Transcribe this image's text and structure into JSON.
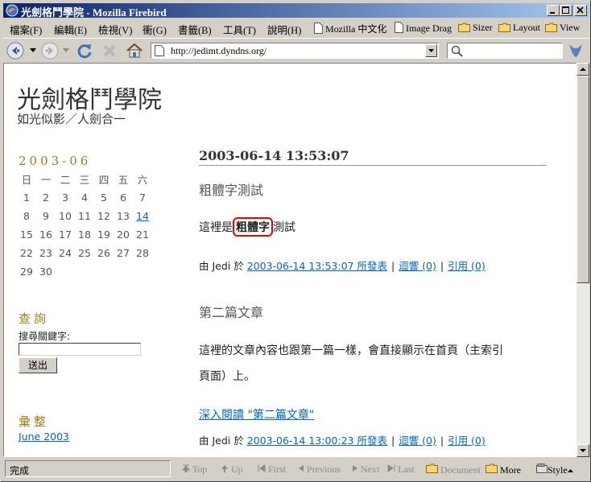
{
  "window": {
    "title": "光劍格鬥學院 - Mozilla Firebird"
  },
  "menubar": {
    "items": [
      "檔案(F)",
      "編輯(E)",
      "檢視(V)",
      "衝(G)",
      "書籤(B)",
      "工具(T)",
      "說明(H)"
    ],
    "bookmarks": [
      "Mozilla 中文化",
      "Image Drag",
      "Sizer",
      "Layout",
      "View"
    ]
  },
  "nav": {
    "url": "http://jedimt.dyndns.org/"
  },
  "site": {
    "title": "光劍格鬥學院",
    "subtitle": "如光似影／人劍合一"
  },
  "calendar": {
    "heading": "2003-06",
    "weekdays": [
      "日",
      "一",
      "二",
      "三",
      "四",
      "五",
      "六"
    ],
    "weeks": [
      [
        "1",
        "2",
        "3",
        "4",
        "5",
        "6",
        "7"
      ],
      [
        "8",
        "9",
        "10",
        "11",
        "12",
        "13",
        "14"
      ],
      [
        "15",
        "16",
        "17",
        "18",
        "19",
        "20",
        "21"
      ],
      [
        "22",
        "23",
        "24",
        "25",
        "26",
        "27",
        "28"
      ],
      [
        "29",
        "30",
        "",
        "",
        "",
        "",
        ""
      ]
    ],
    "today": "14"
  },
  "search": {
    "heading": "查詢",
    "label": "搜尋關鍵字:",
    "button": "送出"
  },
  "archive": {
    "heading": "彙整",
    "link": "June 2003"
  },
  "post1": {
    "date": "2003-06-14 13:53:07",
    "title": "粗體字測試",
    "body_pre": "這裡是",
    "body_bold": "粗體字",
    "body_post": "測試",
    "meta_by": "由 Jedi 於",
    "meta_time": "2003-06-14 13:53:07 所發表",
    "meta_comments": "迴響 (0)",
    "meta_trackback": "引用 (0)"
  },
  "post2": {
    "title": "第二篇文章",
    "body_line1": "這裡的文章內容也跟第一篇一樣，會直接顯示在首頁（主索引",
    "body_line2": "頁面）上。",
    "readmore": "深入閱讀 \"第二篇文章\"",
    "meta_by": "由 Jedi 於",
    "meta_time": "2003-06-14 13:00:23 所發表",
    "meta_comments": "迴響 (0)",
    "meta_trackback": "引用 (0)"
  },
  "statusbar": {
    "status": "完成",
    "nav": [
      "Top",
      "Up",
      "First",
      "Previous",
      "Next",
      "Last",
      "Document",
      "More",
      "Style"
    ]
  }
}
